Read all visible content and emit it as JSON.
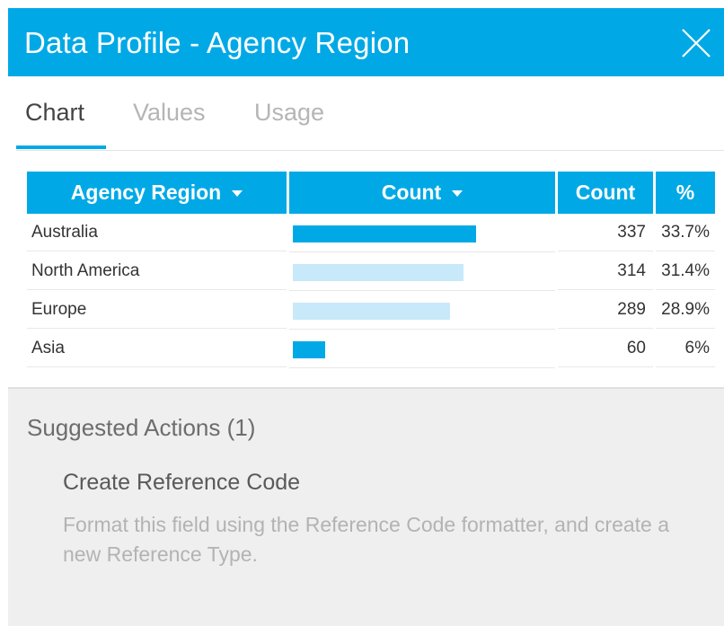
{
  "header": {
    "title": "Data Profile - Agency Region",
    "close_icon": "close-icon"
  },
  "tabs": [
    {
      "label": "Chart",
      "active": true
    },
    {
      "label": "Values",
      "active": false
    },
    {
      "label": "Usage",
      "active": false
    }
  ],
  "table": {
    "headers": {
      "region": "Agency Region",
      "count_bar": "Count",
      "count": "Count",
      "percent": "%"
    },
    "rows": [
      {
        "region": "Australia",
        "count": "337",
        "percent": "33.7%",
        "value": 337,
        "highlight": true
      },
      {
        "region": "North America",
        "count": "314",
        "percent": "31.4%",
        "value": 314,
        "highlight": false
      },
      {
        "region": "Europe",
        "count": "289",
        "percent": "28.9%",
        "value": 289,
        "highlight": false
      },
      {
        "region": "Asia",
        "count": "60",
        "percent": "6%",
        "value": 60,
        "highlight": true
      }
    ]
  },
  "suggested": {
    "title": "Suggested Actions (1)",
    "action_title": "Create Reference Code",
    "action_description": "Format this field using the Reference Code formatter, and create a new Reference Type."
  },
  "colors": {
    "accent": "#00a9e6",
    "bar_primary": "#00a9e6",
    "bar_muted": "#c8e9f9"
  }
}
